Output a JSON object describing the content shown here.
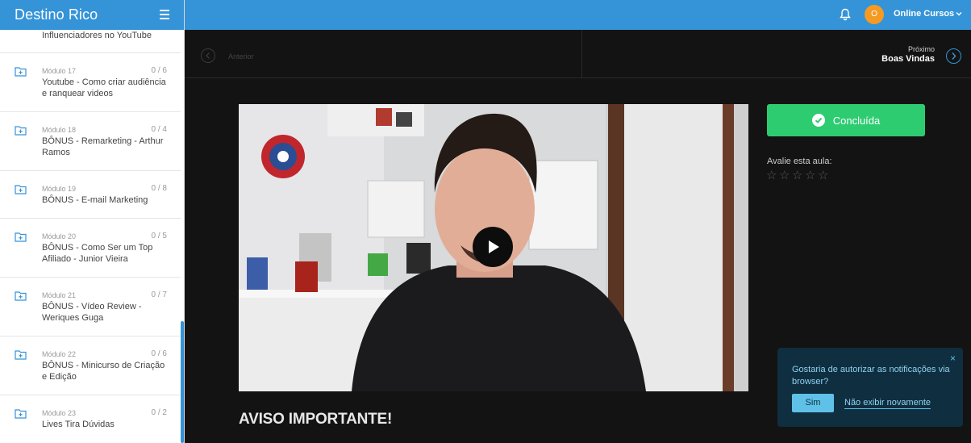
{
  "brand": {
    "title": "Destino Rico"
  },
  "topbar": {
    "avatar_letter": "O",
    "user_name": "Online Cursos"
  },
  "nav": {
    "prev_label": "Anterior",
    "next_small": "Próximo",
    "next_title": "Boas Vindas"
  },
  "sidebar": {
    "partial_item_title": "Influenciadores no YouTube",
    "modules": [
      {
        "num": "Módulo 17",
        "count": "0 / 6",
        "title": "Youtube - Como criar audiência e ranquear videos"
      },
      {
        "num": "Módulo 18",
        "count": "0 / 4",
        "title": "BÔNUS - Remarketing - Arthur Ramos"
      },
      {
        "num": "Módulo 19",
        "count": "0 / 8",
        "title": "BÔNUS - E-mail Marketing"
      },
      {
        "num": "Módulo 20",
        "count": "0 / 5",
        "title": "BÔNUS - Como Ser um Top Afiliado - Junior Vieira"
      },
      {
        "num": "Módulo 21",
        "count": "0 / 7",
        "title": "BÔNUS - Vídeo Review - Weriques Guga"
      },
      {
        "num": "Módulo 22",
        "count": "0 / 6",
        "title": "BÔNUS - Minicurso de Criação e Edição"
      },
      {
        "num": "Módulo 23",
        "count": "0 / 2",
        "title": "Lives Tira Dúvidas"
      }
    ]
  },
  "lesson": {
    "done_label": "Concluída",
    "rate_label": "Avalie esta aula:",
    "stars": [
      "☆",
      "☆",
      "☆",
      "☆",
      "☆"
    ],
    "notice_title": "AVISO IMPORTANTE!"
  },
  "notification": {
    "close": "×",
    "text": "Gostaria de autorizar as notificações via browser?",
    "yes": "Sim",
    "no": "Não exibir novamente"
  },
  "colors": {
    "brand_blue": "#3593d8",
    "success_green": "#2ecc71",
    "avatar_orange": "#f59a23",
    "notif_bg": "#0f2e40"
  },
  "icons": [
    "menu-icon",
    "bell-icon",
    "chevron-down-icon",
    "chevron-left-icon",
    "chevron-right-icon",
    "folder-plus-icon",
    "play-icon",
    "check-icon",
    "star-icon",
    "close-icon"
  ]
}
